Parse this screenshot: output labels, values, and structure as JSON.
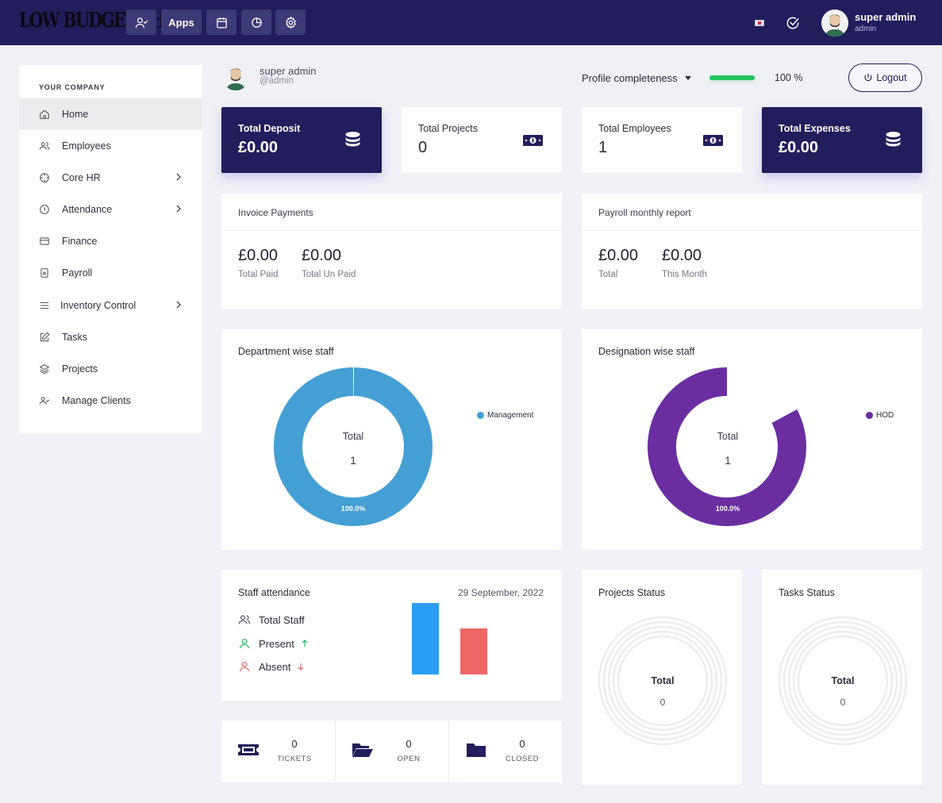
{
  "app": {
    "logo": "LOW BUDGET PHP",
    "apps_label": "Apps"
  },
  "user": {
    "name": "super admin",
    "role": "admin",
    "handle": "@admin"
  },
  "sidebar": {
    "title": "YOUR COMPANY",
    "items": [
      {
        "label": "Home",
        "icon": "home-icon",
        "active": true,
        "has_submenu": false
      },
      {
        "label": "Employees",
        "icon": "users-icon",
        "has_submenu": false
      },
      {
        "label": "Core HR",
        "icon": "crosshair-icon",
        "has_submenu": true
      },
      {
        "label": "Attendance",
        "icon": "clock-icon",
        "has_submenu": true
      },
      {
        "label": "Finance",
        "icon": "credit-card-icon",
        "has_submenu": false
      },
      {
        "label": "Payroll",
        "icon": "calculator-icon",
        "has_submenu": false
      },
      {
        "label": "Inventory Control",
        "icon": "list-icon",
        "has_submenu": true
      },
      {
        "label": "Tasks",
        "icon": "edit-icon",
        "has_submenu": false
      },
      {
        "label": "Projects",
        "icon": "layers-icon",
        "has_submenu": false
      },
      {
        "label": "Manage Clients",
        "icon": "user-check-icon",
        "has_submenu": false
      }
    ]
  },
  "profile": {
    "completeness_label": "Profile completeness",
    "completeness_percent": 100,
    "completeness_text": "100 %",
    "logout_label": "Logout"
  },
  "stats": [
    {
      "label": "Total Deposit",
      "value": "£0.00",
      "icon": "database-icon",
      "dark": true
    },
    {
      "label": "Total Projects",
      "value": "0",
      "icon": "money-icon",
      "dark": false
    },
    {
      "label": "Total Employees",
      "value": "1",
      "icon": "money-icon",
      "dark": false
    },
    {
      "label": "Total Expenses",
      "value": "£0.00",
      "icon": "database-icon",
      "dark": true
    }
  ],
  "invoice": {
    "title": "Invoice Payments",
    "paid_value": "£0.00",
    "paid_label": "Total Paid",
    "unpaid_value": "£0.00",
    "unpaid_label": "Total Un Paid"
  },
  "payroll": {
    "title": "Payroll monthly report",
    "total_value": "£0.00",
    "total_label": "Total",
    "month_value": "£0.00",
    "month_label": "This Month"
  },
  "chart_data": [
    {
      "type": "pie",
      "title": "Department wise staff",
      "center_label": "Total",
      "center_value": "1",
      "categories": [
        "Management"
      ],
      "values": [
        1
      ],
      "slice_labels": [
        "100.0%"
      ],
      "colors": [
        "#449fd5"
      ],
      "legend": "right"
    },
    {
      "type": "pie",
      "title": "Designation wise staff",
      "center_label": "Total",
      "center_value": "1",
      "categories": [
        "HOD"
      ],
      "values": [
        1
      ],
      "slice_labels": [
        "100.0%"
      ],
      "colors": [
        "#6a2ea1"
      ],
      "legend": "right"
    },
    {
      "type": "bar",
      "title": "Staff attendance",
      "categories": [
        "Present",
        "Absent"
      ],
      "values": [
        1,
        0.65
      ],
      "colors": [
        "#2b9ef5",
        "#ee6766"
      ],
      "ylim": [
        0,
        1
      ]
    }
  ],
  "attendance": {
    "title": "Staff attendance",
    "date": "29 September, 2022",
    "total_label": "Total Staff",
    "present_label": "Present",
    "absent_label": "Absent"
  },
  "tickets": [
    {
      "value": "0",
      "label": "TICKETS",
      "icon": "ticket-icon"
    },
    {
      "value": "0",
      "label": "OPEN",
      "icon": "folder-open-icon"
    },
    {
      "value": "0",
      "label": "CLOSED",
      "icon": "folder-icon"
    }
  ],
  "projects_status": {
    "title": "Projects Status",
    "total_label": "Total",
    "total_value": "0"
  },
  "tasks_status": {
    "title": "Tasks Status",
    "total_label": "Total",
    "total_value": "0"
  },
  "colors": {
    "primary": "#221d5c",
    "success": "#22c55e",
    "present": "#2b9ef5",
    "absent": "#ee6766"
  }
}
